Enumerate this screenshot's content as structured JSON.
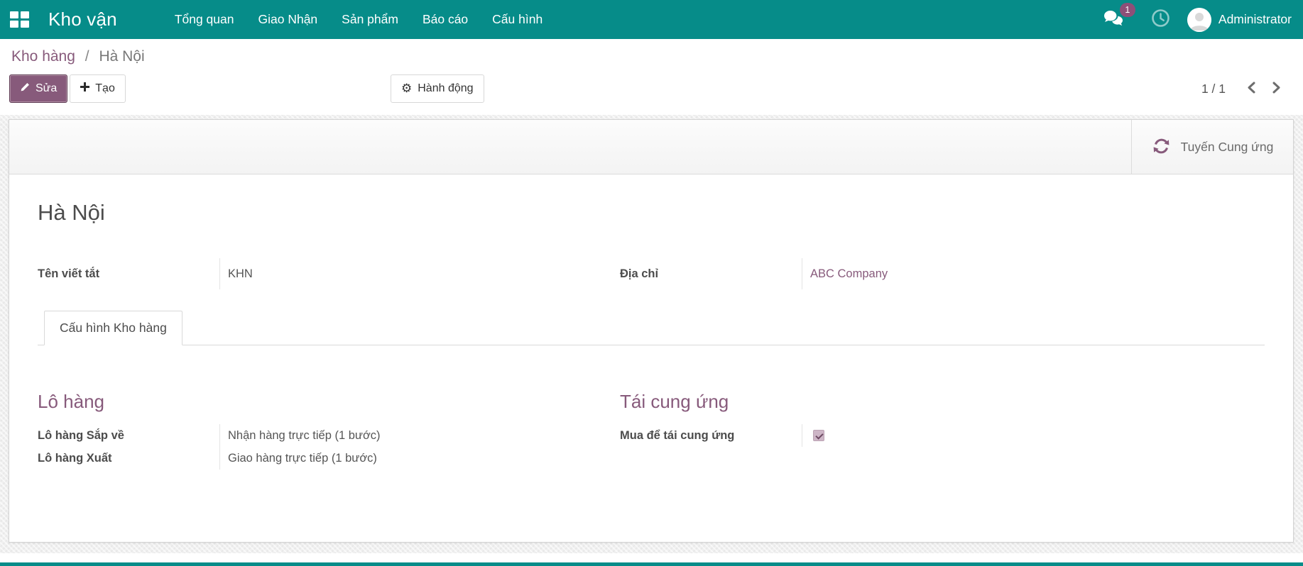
{
  "colors": {
    "navbar_bg": "#068c89",
    "primary": "#875a7b",
    "link": "#875a7b",
    "badge_bg": "#8d4f78"
  },
  "navbar": {
    "brand": "Kho vận",
    "menu_items": [
      {
        "label": "Tổng quan"
      },
      {
        "label": "Giao Nhận"
      },
      {
        "label": "Sản phẩm"
      },
      {
        "label": "Báo cáo"
      },
      {
        "label": "Cấu hình"
      }
    ],
    "messages": {
      "icon": "chat-bubbles-icon",
      "badge": "1"
    },
    "activity": {
      "icon": "clock-icon"
    },
    "user": {
      "name": "Administrator",
      "icon": "avatar"
    }
  },
  "breadcrumb": {
    "parent": "Kho hàng",
    "separator": "/",
    "current": "Hà Nội"
  },
  "control_panel": {
    "edit_button": "Sửa",
    "create_button": "Tạo",
    "action_button": "Hành động",
    "action_icon_glyph": "⚙",
    "pager": {
      "text": "1 / 1"
    }
  },
  "form": {
    "smart_button": {
      "icon": "refresh-icon",
      "label": "Tuyến Cung ứng"
    },
    "title": "Hà Nội",
    "top_fields": {
      "left": {
        "label": "Tên viết tắt",
        "value": "KHN"
      },
      "right": {
        "label": "Địa chỉ",
        "value": "ABC Company"
      }
    },
    "tabs": [
      {
        "label": "Cấu hình Kho hàng",
        "active": true
      }
    ],
    "sections": {
      "shipments": {
        "title": "Lô hàng",
        "rows": [
          {
            "label": "Lô hàng Sắp về",
            "value": "Nhận hàng trực tiếp (1 bước)"
          },
          {
            "label": "Lô hàng Xuất",
            "value": "Giao hàng trực tiếp (1 bước)"
          }
        ]
      },
      "resupply": {
        "title": "Tái cung ứng",
        "rows": [
          {
            "label": "Mua để tái cung ứng",
            "checkbox": true
          }
        ]
      }
    }
  }
}
